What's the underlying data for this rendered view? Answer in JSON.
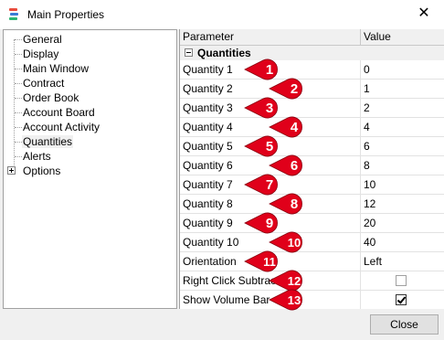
{
  "window": {
    "title": "Main Properties",
    "close_glyph": "✕"
  },
  "tree": {
    "items": [
      {
        "label": "General"
      },
      {
        "label": "Display"
      },
      {
        "label": "Main Window"
      },
      {
        "label": "Contract"
      },
      {
        "label": "Order Book"
      },
      {
        "label": "Account Board"
      },
      {
        "label": "Account Activity"
      },
      {
        "label": "Quantities",
        "selected": true
      },
      {
        "label": "Alerts"
      },
      {
        "label": "Options",
        "expandable": true
      }
    ]
  },
  "grid": {
    "headers": {
      "parameter": "Parameter",
      "value": "Value"
    },
    "category": "Quantities",
    "rows": [
      {
        "param": "Quantity 1",
        "value": "0",
        "marker": "1"
      },
      {
        "param": "Quantity 2",
        "value": "1",
        "marker": "2"
      },
      {
        "param": "Quantity 3",
        "value": "2",
        "marker": "3"
      },
      {
        "param": "Quantity 4",
        "value": "4",
        "marker": "4"
      },
      {
        "param": "Quantity 5",
        "value": "6",
        "marker": "5"
      },
      {
        "param": "Quantity 6",
        "value": "8",
        "marker": "6"
      },
      {
        "param": "Quantity 7",
        "value": "10",
        "marker": "7"
      },
      {
        "param": "Quantity 8",
        "value": "12",
        "marker": "8"
      },
      {
        "param": "Quantity 9",
        "value": "20",
        "marker": "9"
      },
      {
        "param": "Quantity 10",
        "value": "40",
        "marker": "10"
      },
      {
        "param": "Orientation",
        "value": "Left",
        "marker": "11"
      },
      {
        "param": "Right Click Subtract",
        "value": "",
        "checkbox": true,
        "checked": false,
        "marker": "12"
      },
      {
        "param": "Show Volume Bar",
        "value": "",
        "checkbox": true,
        "checked": true,
        "marker": "13"
      }
    ]
  },
  "footer": {
    "close_label": "Close"
  },
  "colors": {
    "marker_red": "#e0001a",
    "marker_dark": "#8a0010",
    "selection": "#f0f0f0"
  }
}
